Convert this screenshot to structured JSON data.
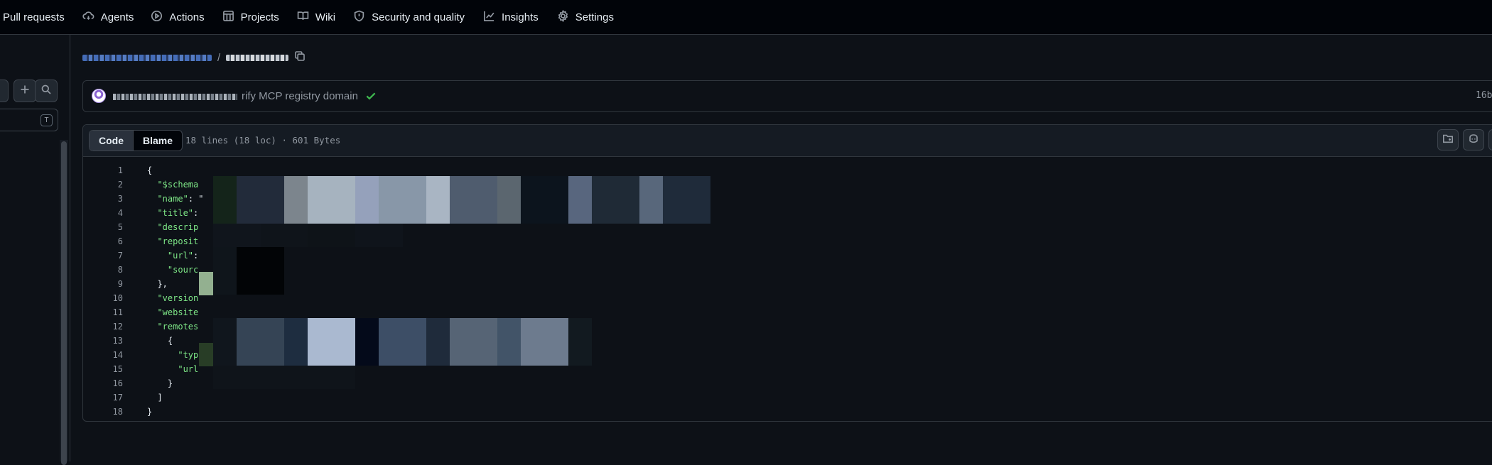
{
  "topnav": {
    "items": [
      {
        "label": "Pull requests",
        "icon": "pull-request-icon"
      },
      {
        "label": "Agents",
        "icon": "agents-icon"
      },
      {
        "label": "Actions",
        "icon": "play-icon"
      },
      {
        "label": "Projects",
        "icon": "table-icon"
      },
      {
        "label": "Wiki",
        "icon": "book-icon"
      },
      {
        "label": "Security and quality",
        "icon": "shield-icon"
      },
      {
        "label": "Insights",
        "icon": "graph-icon"
      },
      {
        "label": "Settings",
        "icon": "gear-icon"
      }
    ]
  },
  "file_tree": {
    "filter_shortcut": "T"
  },
  "breadcrumb": {
    "separator": "/"
  },
  "commit": {
    "message": "rify MCP registry domain",
    "sha_partial": "16b"
  },
  "file": {
    "tabs": {
      "code": "Code",
      "blame": "Blame"
    },
    "meta": "18 lines (18 loc) · 601 Bytes",
    "lines": [
      {
        "n": "1",
        "indent": "",
        "key": "",
        "rest": "{"
      },
      {
        "n": "2",
        "indent": "  ",
        "key": "\"$schema",
        "rest": ""
      },
      {
        "n": "3",
        "indent": "  ",
        "key": "\"name\"",
        "rest": ": \""
      },
      {
        "n": "4",
        "indent": "  ",
        "key": "\"title\"",
        "rest": ":"
      },
      {
        "n": "5",
        "indent": "  ",
        "key": "\"descrip",
        "rest": ""
      },
      {
        "n": "6",
        "indent": "  ",
        "key": "\"reposit",
        "rest": ""
      },
      {
        "n": "7",
        "indent": "    ",
        "key": "\"url\"",
        "rest": ":"
      },
      {
        "n": "8",
        "indent": "    ",
        "key": "\"sourc",
        "rest": ""
      },
      {
        "n": "9",
        "indent": "  ",
        "key": "",
        "rest": "},"
      },
      {
        "n": "10",
        "indent": "  ",
        "key": "\"version",
        "rest": ""
      },
      {
        "n": "11",
        "indent": "  ",
        "key": "\"website",
        "rest": ""
      },
      {
        "n": "12",
        "indent": "  ",
        "key": "\"remotes",
        "rest": ""
      },
      {
        "n": "13",
        "indent": "    ",
        "key": "",
        "rest": "{"
      },
      {
        "n": "14",
        "indent": "      ",
        "key": "\"typ",
        "rest": ""
      },
      {
        "n": "15",
        "indent": "      ",
        "key": "\"url",
        "rest": ""
      },
      {
        "n": "16",
        "indent": "    ",
        "key": "",
        "rest": "}"
      },
      {
        "n": "17",
        "indent": "  ",
        "key": "",
        "rest": "]"
      },
      {
        "n": "18",
        "indent": "",
        "key": "",
        "rest": "}"
      }
    ]
  },
  "colors": {
    "bg": "#0d1117",
    "nav_bg": "#010409",
    "border": "#30363d",
    "json_key": "#7ee787",
    "success": "#3fb950",
    "muted": "#9198a1"
  }
}
